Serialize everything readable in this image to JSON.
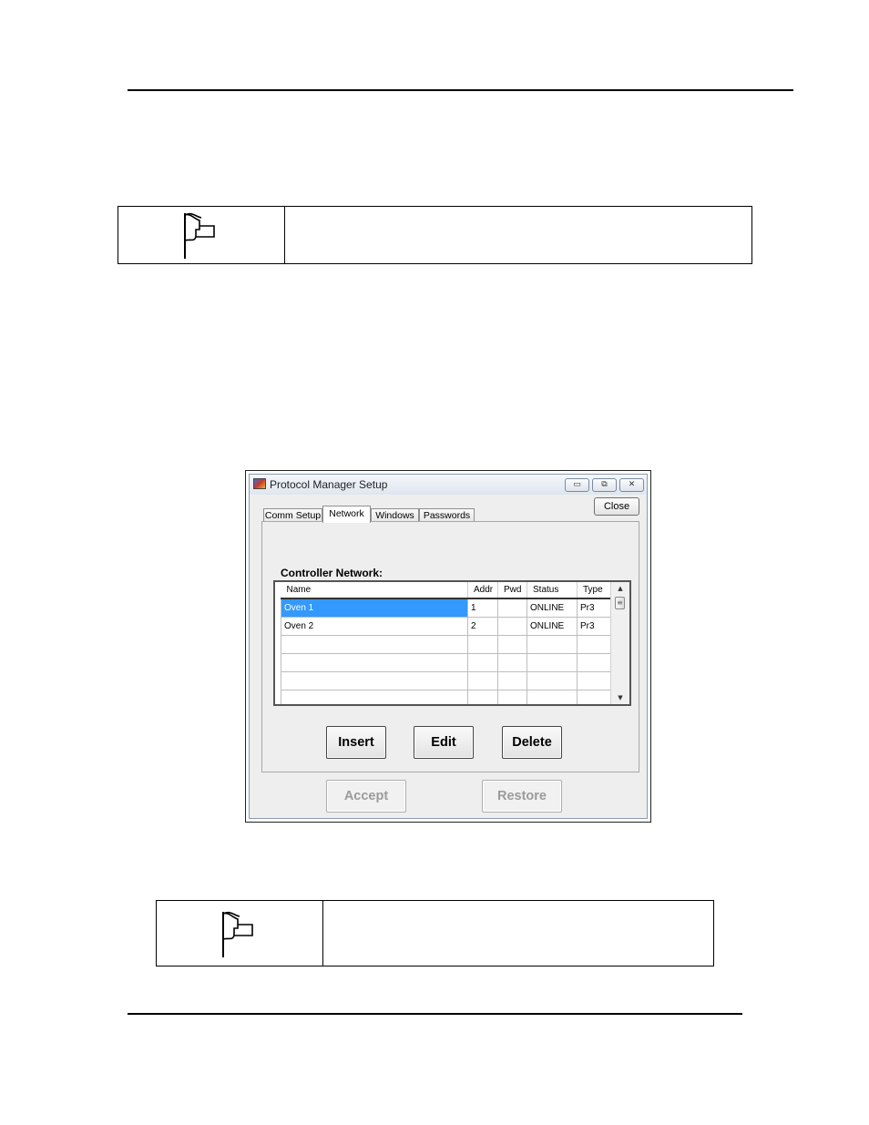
{
  "window": {
    "title": "Protocol Manager Setup",
    "minimize_glyph": "▭",
    "restore_glyph": "⧉",
    "close_glyph": "✕",
    "close_button": "Close"
  },
  "tabs": [
    {
      "label": "Comm Setup",
      "active": false
    },
    {
      "label": "Network",
      "active": true
    },
    {
      "label": "Windows",
      "active": false
    },
    {
      "label": "Passwords",
      "active": false
    }
  ],
  "network": {
    "section_label": "Controller Network:",
    "columns": [
      "Name",
      "Addr",
      "Pwd",
      "Status",
      "Type"
    ],
    "rows": [
      {
        "name": "Oven 1",
        "addr": "1",
        "pwd": "",
        "status": "ONLINE",
        "type": "Pr3",
        "selected": true
      },
      {
        "name": "Oven 2",
        "addr": "2",
        "pwd": "",
        "status": "ONLINE",
        "type": "Pr3",
        "selected": false
      }
    ],
    "buttons": {
      "insert": "Insert",
      "edit": "Edit",
      "delete": "Delete"
    }
  },
  "footer_buttons": {
    "accept": "Accept",
    "restore": "Restore"
  },
  "icons": {
    "note_icon": "flag-icon",
    "scroll_up": "▲",
    "scroll_down": "▼",
    "scroll_grip": "≡"
  }
}
